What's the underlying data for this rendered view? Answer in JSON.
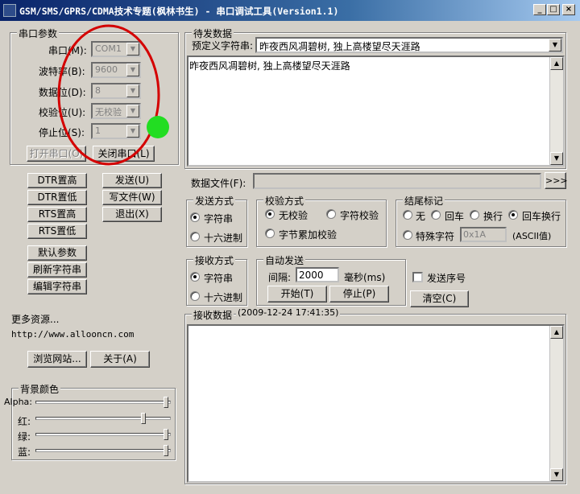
{
  "window": {
    "title": "GSM/SMS/GPRS/CDMA技术专题(枫林书生) - 串口调试工具(Version1.1)",
    "min": "_",
    "max": "□",
    "close": "×"
  },
  "serial": {
    "group": "串口参数",
    "port_label": "串口(M):",
    "port": "COM1",
    "baud_label": "波特率(B):",
    "baud": "9600",
    "data_label": "数据位(D):",
    "data": "8",
    "parity_label": "校验位(U):",
    "parity": "无校验",
    "stop_label": "停止位(S):",
    "stop": "1",
    "open": "打开串口(O)",
    "close": "关闭串口(L)"
  },
  "ctrl": {
    "dtr_high": "DTR置高",
    "dtr_low": "DTR置低",
    "rts_high": "RTS置高",
    "rts_low": "RTS置低",
    "send": "发送(U)",
    "write_file": "写文件(W)",
    "exit": "退出(X)",
    "defaults": "默认参数",
    "refresh": "刷新字符串",
    "edit": "编辑字符串"
  },
  "more": {
    "label": "更多资源...",
    "url": "http://www.allooncn.com",
    "browse": "浏览网站...",
    "about": "关于(A)"
  },
  "bg": {
    "group": "背景颜色",
    "alpha": "Alpha:",
    "red": "红:",
    "green": "绿:",
    "blue": "蓝:",
    "alpha_v": 1.0,
    "red_v": 0.82,
    "green_v": 1.0,
    "blue_v": 1.0
  },
  "pending": {
    "group": "待发数据",
    "preset_label": "预定义字符串:",
    "preset": "昨夜西风凋碧树, 独上高楼望尽天涯路",
    "text": "昨夜西风凋碧树, 独上高楼望尽天涯路"
  },
  "file": {
    "label": "数据文件(F):",
    "browse": ">>>"
  },
  "send_mode": {
    "group": "发送方式",
    "str": "字符串",
    "hex": "十六进制"
  },
  "check": {
    "group": "校验方式",
    "none": "无校验",
    "char": "字符校验",
    "sum": "字节累加校验"
  },
  "tail": {
    "group": "结尾标记",
    "none": "无",
    "cr": "回车",
    "lf": "换行",
    "crlf": "回车换行",
    "special": "特殊字符",
    "special_val": "0x1A",
    "ascii": "(ASCII值)"
  },
  "recv_mode": {
    "group": "接收方式",
    "str": "字符串",
    "hex": "十六进制"
  },
  "auto": {
    "group": "自动发送",
    "interval_label": "间隔:",
    "interval": "2000",
    "unit": "毫秒(ms)",
    "start": "开始(T)",
    "stop": "停止(P)"
  },
  "seq": {
    "label": "发送序号",
    "clear": "清空(C)"
  },
  "recv": {
    "group": "接收数据",
    "time": "(2009-12-24 17:41:35)"
  },
  "colors": {
    "annotation": "#d40000",
    "dot": "#22dd22"
  }
}
